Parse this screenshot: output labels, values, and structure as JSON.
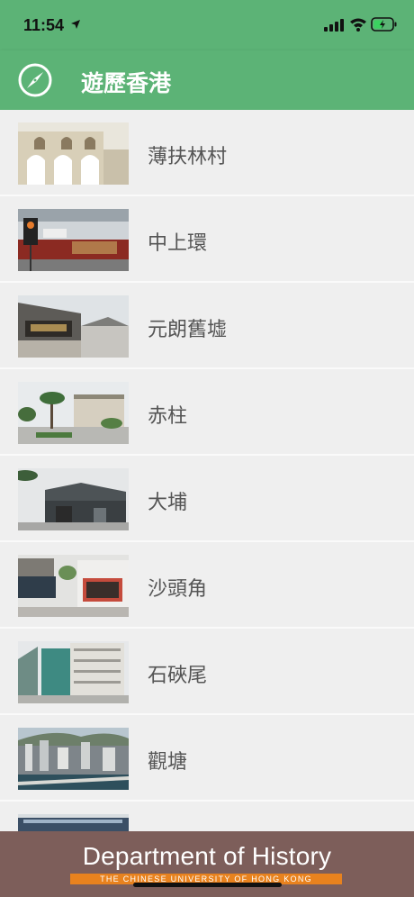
{
  "status": {
    "time": "11:54"
  },
  "app": {
    "title": "遊歷香港"
  },
  "places": [
    {
      "name": "薄扶林村"
    },
    {
      "name": "中上環"
    },
    {
      "name": "元朗舊墟"
    },
    {
      "name": "赤柱"
    },
    {
      "name": "大埔"
    },
    {
      "name": "沙頭角"
    },
    {
      "name": "石硤尾"
    },
    {
      "name": "觀塘"
    },
    {
      "name": ""
    }
  ],
  "footer": {
    "title": "Department of History",
    "subtitle": "THE CHINESE UNIVERSITY OF HONG KONG"
  },
  "colors": {
    "header": "#5cb376",
    "footer": "#7d5e5a",
    "footer_accent": "#e8821e"
  }
}
